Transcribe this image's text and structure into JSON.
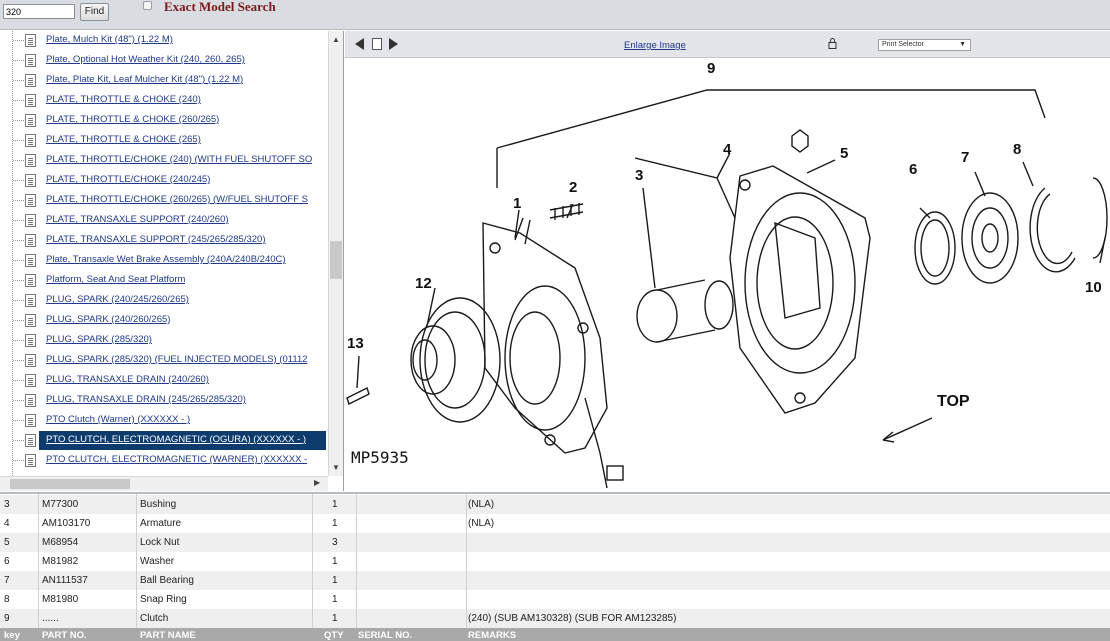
{
  "search": {
    "value": "320",
    "find_label": "Find",
    "exact_label": "Exact Model Search"
  },
  "tree": {
    "items": [
      {
        "label": "Plate, Mulch Kit (48\") (1.22 M)"
      },
      {
        "label": "Plate, Optional Hot Weather Kit (240, 260, 265)"
      },
      {
        "label": "Plate, Plate Kit, Leaf Mulcher Kit (48\") (1.22 M)"
      },
      {
        "label": "PLATE, THROTTLE & CHOKE (240)"
      },
      {
        "label": "PLATE, THROTTLE & CHOKE (260/265)"
      },
      {
        "label": "PLATE, THROTTLE & CHOKE (265)"
      },
      {
        "label": "PLATE, THROTTLE/CHOKE (240) (WITH FUEL SHUTOFF SO"
      },
      {
        "label": "PLATE, THROTTLE/CHOKE (240/245)"
      },
      {
        "label": "PLATE, THROTTLE/CHOKE (260/265) (W/FUEL SHUTOFF S"
      },
      {
        "label": "PLATE, TRANSAXLE SUPPORT (240/260)"
      },
      {
        "label": "PLATE, TRANSAXLE SUPPORT (245/265/285/320)"
      },
      {
        "label": "Plate, Transaxle Wet Brake Assembly (240A/240B/240C)"
      },
      {
        "label": "Platform, Seat And Seat Platform"
      },
      {
        "label": "PLUG, SPARK (240/245/260/265)"
      },
      {
        "label": "PLUG, SPARK (240/260/265)"
      },
      {
        "label": "PLUG, SPARK (285/320)"
      },
      {
        "label": "PLUG, SPARK (285/320) (FUEL INJECTED MODELS) (01112"
      },
      {
        "label": "PLUG, TRANSAXLE DRAIN (240/260)"
      },
      {
        "label": "PLUG, TRANSAXLE DRAIN (245/265/285/320)"
      },
      {
        "label": "PTO Clutch (Warner) (XXXXXX - )"
      },
      {
        "label": "PTO CLUTCH, ELECTROMAGNETIC (OGURA) (XXXXXX - )"
      },
      {
        "label": "PTO CLUTCH, ELECTROMAGNETIC (WARNER) (XXXXXX - "
      }
    ],
    "selected_index": 20
  },
  "viewer": {
    "enlarge_label": "Enlarge Image",
    "print_selector": "Print Selector",
    "diagram": {
      "code": "MP5935",
      "top_label": "TOP",
      "callouts": [
        "1",
        "2",
        "3",
        "4",
        "5",
        "6",
        "7",
        "8",
        "9",
        "10",
        "12",
        "13"
      ]
    }
  },
  "parts": {
    "headers": [
      "key",
      "PART NO.",
      "PART NAME",
      "QTY",
      "SERIAL NO.",
      "REMARKS"
    ],
    "rows": [
      {
        "key": "3",
        "part_no": "M77300",
        "name": "Bushing",
        "qty": "1",
        "serial": "",
        "remarks": "(NLA)"
      },
      {
        "key": "4",
        "part_no": "AM103170",
        "name": "Armature",
        "qty": "1",
        "serial": "",
        "remarks": "(NLA)"
      },
      {
        "key": "5",
        "part_no": "M68954",
        "name": "Lock Nut",
        "qty": "3",
        "serial": "",
        "remarks": ""
      },
      {
        "key": "6",
        "part_no": "M81982",
        "name": "Washer",
        "qty": "1",
        "serial": "",
        "remarks": ""
      },
      {
        "key": "7",
        "part_no": "AN111537",
        "name": "Ball Bearing",
        "qty": "1",
        "serial": "",
        "remarks": ""
      },
      {
        "key": "8",
        "part_no": "M81980",
        "name": "Snap Ring",
        "qty": "1",
        "serial": "",
        "remarks": ""
      },
      {
        "key": "9",
        "part_no": "......",
        "name": "Clutch",
        "qty": "1",
        "serial": "",
        "remarks": "(240) (SUB AM130328) (SUB FOR AM123285)"
      }
    ]
  }
}
